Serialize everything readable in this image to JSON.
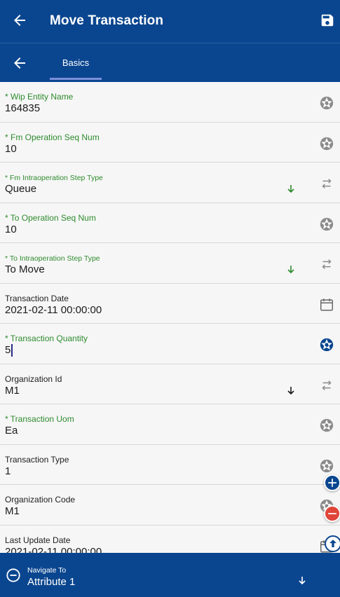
{
  "header": {
    "title": "Move Transaction",
    "back_icon": "arrow-left-icon",
    "save_icon": "save-icon"
  },
  "tabs": {
    "back_icon": "arrow-left-icon",
    "items": [
      {
        "label": "Basics",
        "active": true
      }
    ]
  },
  "fields": [
    {
      "label": "* Wip Entity Name",
      "value": "164835",
      "required": true,
      "action": "aperture"
    },
    {
      "label": "* Fm Operation Seq Num",
      "value": "10",
      "required": true,
      "action": "aperture"
    },
    {
      "label": "* Fm Intraoperation Step Type",
      "value": "Queue",
      "required": true,
      "action": "swap",
      "dropdown": true
    },
    {
      "label": "* To Operation Seq Num",
      "value": "10",
      "required": true,
      "action": "aperture"
    },
    {
      "label": "* To Intraoperation Step Type",
      "value": "To Move",
      "required": true,
      "action": "swap",
      "dropdown": true
    },
    {
      "label": "Transaction Date",
      "value": "2021-02-11 00:00:00",
      "required": false,
      "action": "calendar"
    },
    {
      "label": "* Transaction Quantity",
      "value": "5",
      "required": true,
      "action": "aperture-active"
    },
    {
      "label": "Organization Id",
      "value": "M1",
      "required": false,
      "action": "swap",
      "dropdown": true
    },
    {
      "label": "* Transaction Uom",
      "value": "Ea",
      "required": true,
      "action": "aperture"
    },
    {
      "label": "Transaction Type",
      "value": "1",
      "required": false,
      "action": "aperture"
    },
    {
      "label": "Organization Code",
      "value": "M1",
      "required": false,
      "action": "aperture"
    },
    {
      "label": "Last Update Date",
      "value": "2021-02-11 00:00:00",
      "required": false,
      "action": "calendar"
    }
  ],
  "footer": {
    "nav_label": "Navigate To",
    "nav_value": "Attribute 1"
  },
  "colors": {
    "primary": "#0a468f",
    "required_label": "#2e8b2e",
    "danger": "#e0453a"
  }
}
